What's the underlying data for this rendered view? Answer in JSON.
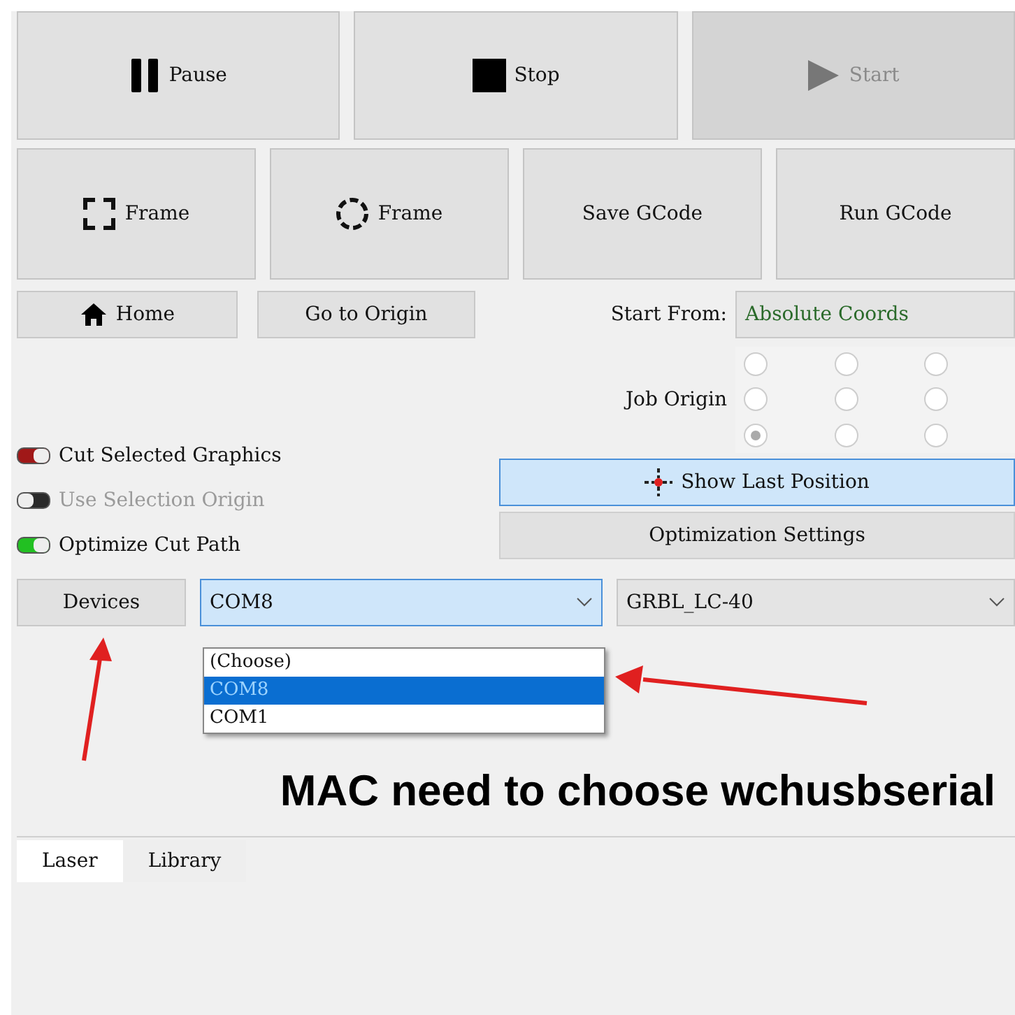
{
  "main_buttons": [
    {
      "label": "Pause",
      "kind": "pause",
      "disabled": false
    },
    {
      "label": "Stop",
      "kind": "stop",
      "disabled": false
    },
    {
      "label": "Start",
      "kind": "play",
      "disabled": true
    }
  ],
  "frame_buttons": [
    {
      "label": "Frame",
      "kind": "square"
    },
    {
      "label": "Frame",
      "kind": "circle"
    },
    {
      "label": "Save GCode",
      "kind": "plain"
    },
    {
      "label": "Run GCode",
      "kind": "plain"
    }
  ],
  "home_button": "Home",
  "origin_button": "Go to Origin",
  "start_from": {
    "label": "Start From:",
    "value": "Absolute Coords"
  },
  "job_origin": {
    "label": "Job Origin",
    "radios": [
      {
        "selected": false
      },
      {
        "selected": false
      },
      {
        "selected": false
      },
      {
        "selected": false
      },
      {
        "selected": false
      },
      {
        "selected": false
      },
      {
        "selected": true
      },
      {
        "selected": false
      },
      {
        "selected": false
      }
    ]
  },
  "toggles": [
    {
      "label": "Cut Selected Graphics",
      "on": true,
      "disabled": false,
      "color": "#a01818"
    },
    {
      "label": "Use Selection Origin",
      "on": false,
      "disabled": true,
      "color": "#2a2a2a"
    },
    {
      "label": "Optimize Cut Path",
      "on": true,
      "disabled": false,
      "color": "#22c022"
    }
  ],
  "show_last_position": "Show Last Position",
  "optimization_settings": "Optimization Settings",
  "devices_button": "Devices",
  "port_select": {
    "value": "COM8",
    "options": [
      {
        "label": "(Choose)",
        "selected": false
      },
      {
        "label": "COM8",
        "selected": true
      },
      {
        "label": "COM1",
        "selected": false
      }
    ]
  },
  "device_select": {
    "value": "GRBL_LC-40"
  },
  "annotation": "MAC need to choose wchusbserial",
  "tabs": [
    {
      "label": "Laser",
      "selected": true
    },
    {
      "label": "Library",
      "selected": false
    }
  ]
}
